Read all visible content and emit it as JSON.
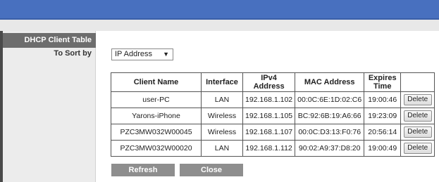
{
  "page": {
    "section_title": "DHCP Client Table",
    "sort_label": "To Sort by"
  },
  "sort_select": {
    "value": "IP Address",
    "icon": "triangle-down"
  },
  "table": {
    "headers": [
      "Client Name",
      "Interface",
      "IPv4 Address",
      "MAC Address",
      "Expires Time"
    ],
    "rows": [
      {
        "client_name": "user-PC",
        "interface": "LAN",
        "ipv4": "192.168.1.102",
        "mac": "00:0C:6E:1D:02:C6",
        "expires": "19:00:46",
        "action": "Delete"
      },
      {
        "client_name": "Yarons-iPhone",
        "interface": "Wireless",
        "ipv4": "192.168.1.105",
        "mac": "BC:92:6B:19:A6:66",
        "expires": "19:23:09",
        "action": "Delete"
      },
      {
        "client_name": "PZC3MW032W00045",
        "interface": "Wireless",
        "ipv4": "192.168.1.107",
        "mac": "00:0C:D3:13:F0:76",
        "expires": "20:56:14",
        "action": "Delete"
      },
      {
        "client_name": "PZC3MW032W00020",
        "interface": "LAN",
        "ipv4": "192.168.1.112",
        "mac": "90:02:A9:37:D8:20",
        "expires": "19:00:49",
        "action": "Delete"
      }
    ]
  },
  "buttons": {
    "refresh": "Refresh",
    "close": "Close"
  },
  "colors": {
    "header_bar": "#4870bf",
    "section_title_bg": "#6d6d6d",
    "button_bg": "#8e8e8e"
  }
}
